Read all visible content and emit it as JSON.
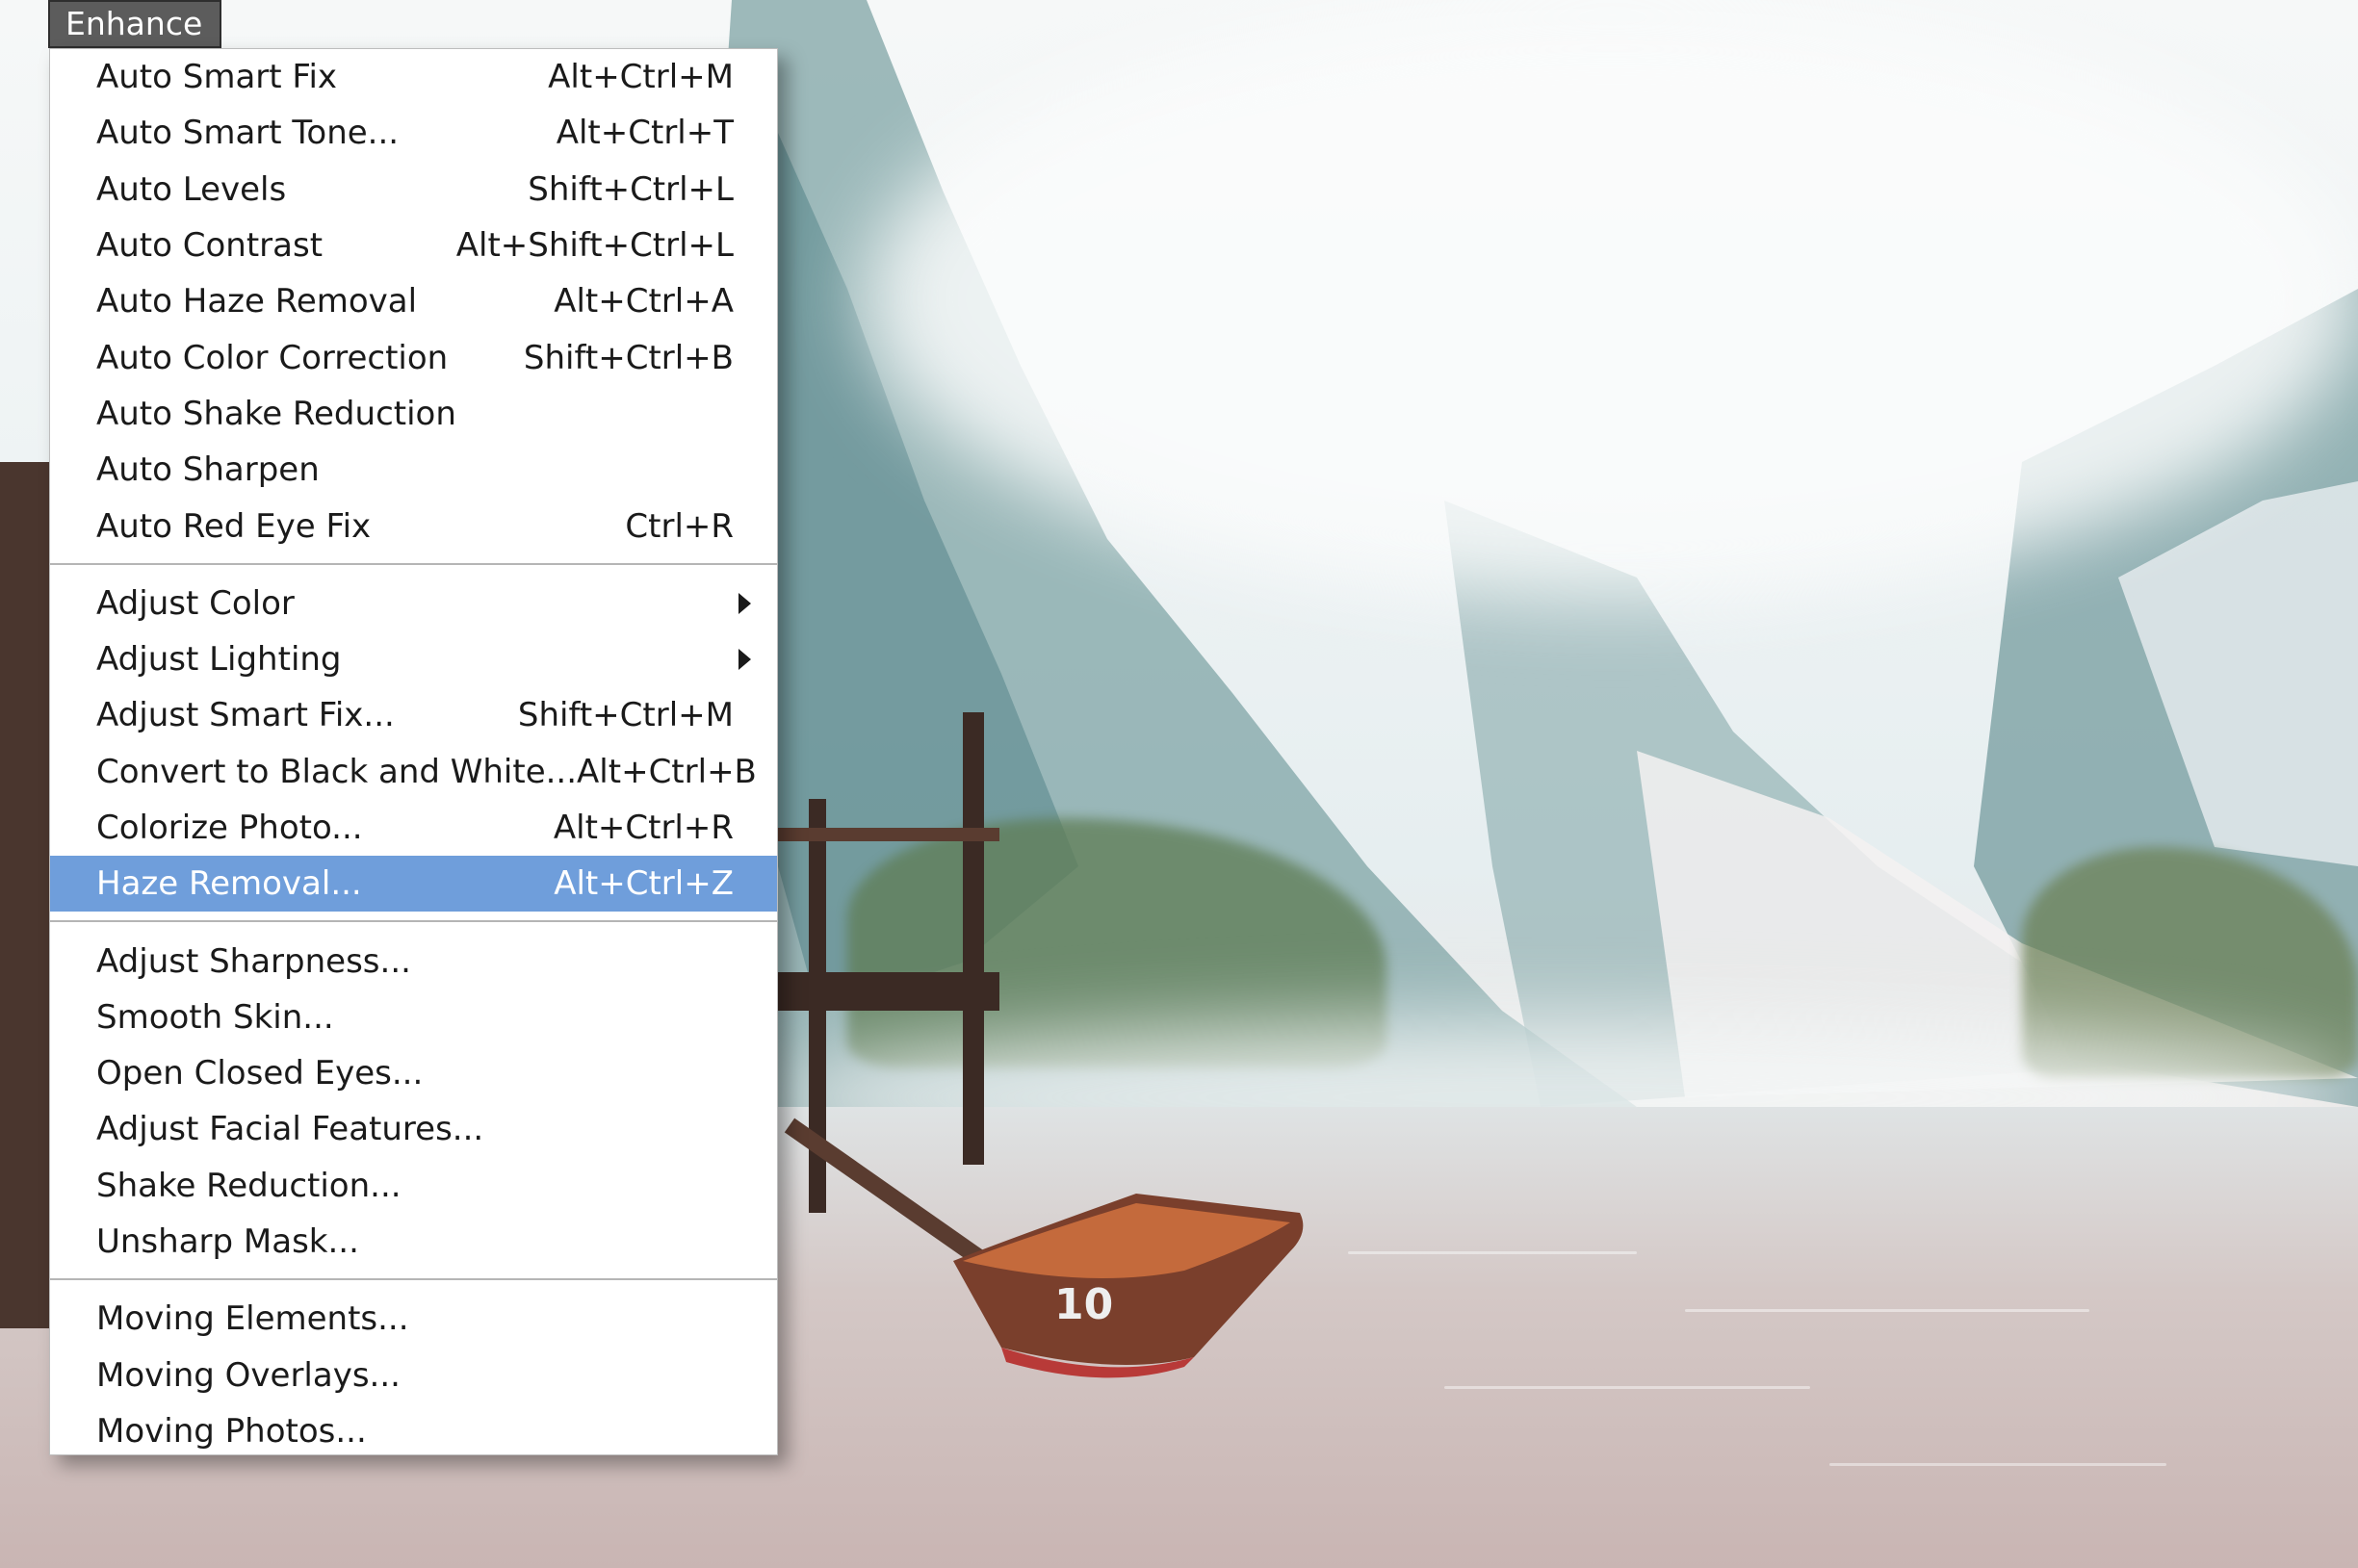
{
  "menu_title": "Enhance",
  "menu": {
    "groups": [
      [
        {
          "label": "Auto Smart Fix",
          "shortcut": "Alt+Ctrl+M"
        },
        {
          "label": "Auto Smart Tone...",
          "shortcut": "Alt+Ctrl+T"
        },
        {
          "label": "Auto Levels",
          "shortcut": "Shift+Ctrl+L"
        },
        {
          "label": "Auto Contrast",
          "shortcut": "Alt+Shift+Ctrl+L"
        },
        {
          "label": "Auto Haze Removal",
          "shortcut": "Alt+Ctrl+A"
        },
        {
          "label": "Auto Color Correction",
          "shortcut": "Shift+Ctrl+B"
        },
        {
          "label": "Auto Shake Reduction",
          "shortcut": ""
        },
        {
          "label": "Auto Sharpen",
          "shortcut": ""
        },
        {
          "label": "Auto Red Eye Fix",
          "shortcut": "Ctrl+R"
        }
      ],
      [
        {
          "label": "Adjust Color",
          "shortcut": "",
          "submenu": true
        },
        {
          "label": "Adjust Lighting",
          "shortcut": "",
          "submenu": true
        },
        {
          "label": "Adjust Smart Fix...",
          "shortcut": "Shift+Ctrl+M"
        },
        {
          "label": "Convert to Black and White...",
          "shortcut": "Alt+Ctrl+B"
        },
        {
          "label": "Colorize Photo...",
          "shortcut": "Alt+Ctrl+R"
        },
        {
          "label": "Haze Removal...",
          "shortcut": "Alt+Ctrl+Z",
          "highlighted": true
        }
      ],
      [
        {
          "label": "Adjust Sharpness...",
          "shortcut": ""
        },
        {
          "label": "Smooth Skin...",
          "shortcut": ""
        },
        {
          "label": "Open Closed Eyes...",
          "shortcut": ""
        },
        {
          "label": "Adjust Facial Features...",
          "shortcut": ""
        },
        {
          "label": "Shake Reduction...",
          "shortcut": ""
        },
        {
          "label": "Unsharp Mask...",
          "shortcut": ""
        }
      ],
      [
        {
          "label": "Moving Elements...",
          "shortcut": ""
        },
        {
          "label": "Moving Overlays...",
          "shortcut": ""
        },
        {
          "label": "Moving Photos...",
          "shortcut": ""
        }
      ]
    ]
  },
  "boat_number": "10",
  "colors": {
    "highlight": "#6f9edb",
    "menu_title_bg": "#5c5c5c"
  }
}
